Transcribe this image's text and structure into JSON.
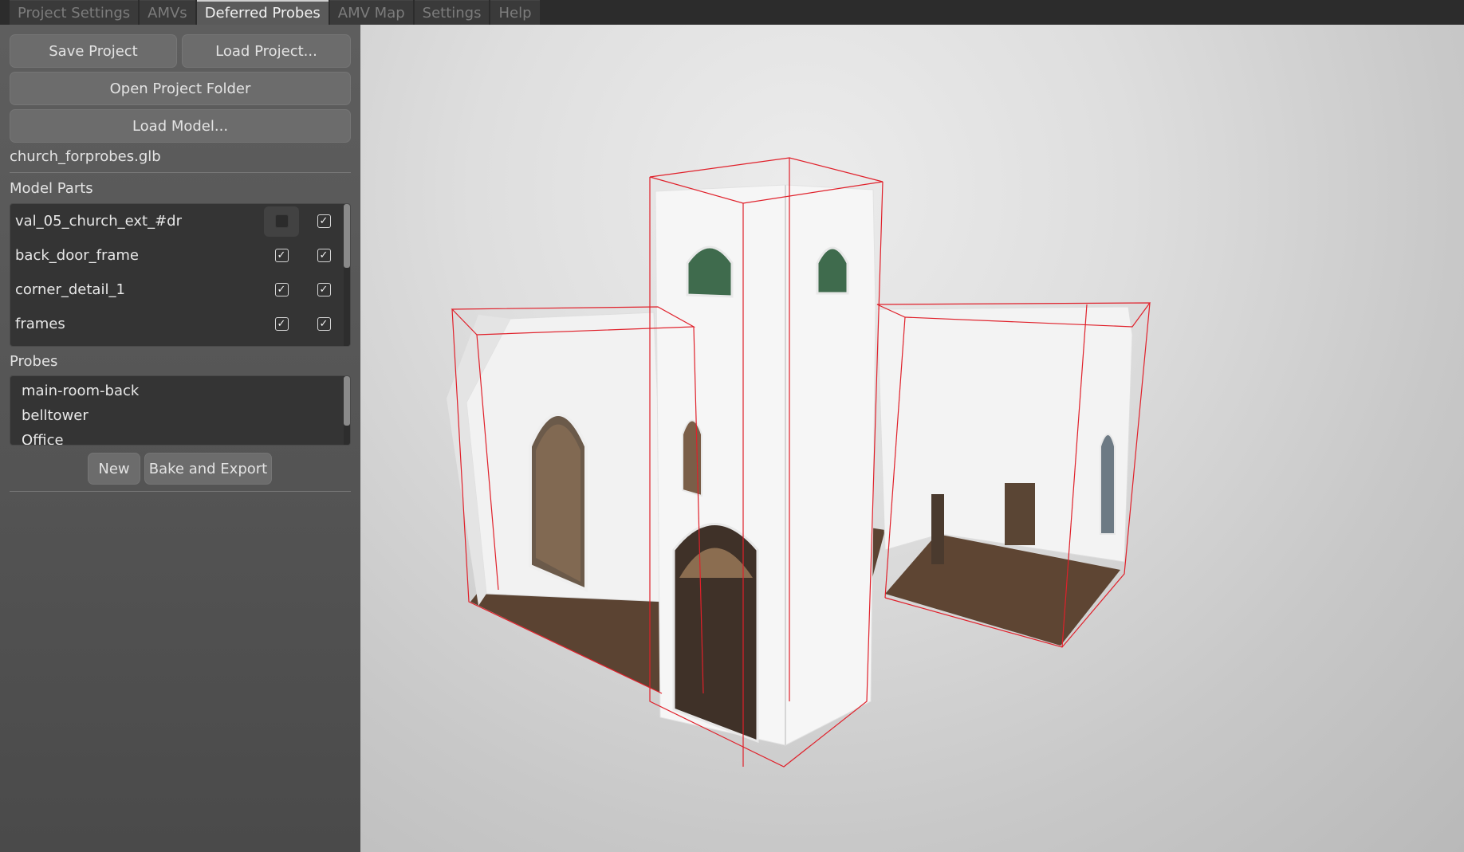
{
  "tabs": [
    {
      "label": "Project Settings",
      "active": false
    },
    {
      "label": "AMVs",
      "active": false
    },
    {
      "label": "Deferred Probes",
      "active": true
    },
    {
      "label": "AMV Map",
      "active": false
    },
    {
      "label": "Settings",
      "active": false
    },
    {
      "label": "Help",
      "active": false
    }
  ],
  "panel": {
    "save_project": "Save Project",
    "load_project": "Load Project...",
    "open_project_folder": "Open Project Folder",
    "load_model": "Load Model...",
    "model_file": "church_forprobes.glb",
    "model_parts_heading": "Model Parts",
    "model_parts": [
      {
        "name": "val_05_church_ext_#dr",
        "check_a": false,
        "check_b": true
      },
      {
        "name": "back_door_frame",
        "check_a": true,
        "check_b": true
      },
      {
        "name": "corner_detail_1",
        "check_a": true,
        "check_b": true
      },
      {
        "name": "frames",
        "check_a": true,
        "check_b": true
      }
    ],
    "probes_heading": "Probes",
    "probes": [
      "main-room-back",
      "belltower",
      "Office"
    ],
    "new_button": "New",
    "bake_button": "Bake and Export"
  },
  "icons": {
    "checkbox_checked": "check-icon"
  },
  "colors": {
    "probe_bounds": "#e0202a",
    "panel_bg": "#5a5a5a",
    "list_bg": "#343434"
  }
}
